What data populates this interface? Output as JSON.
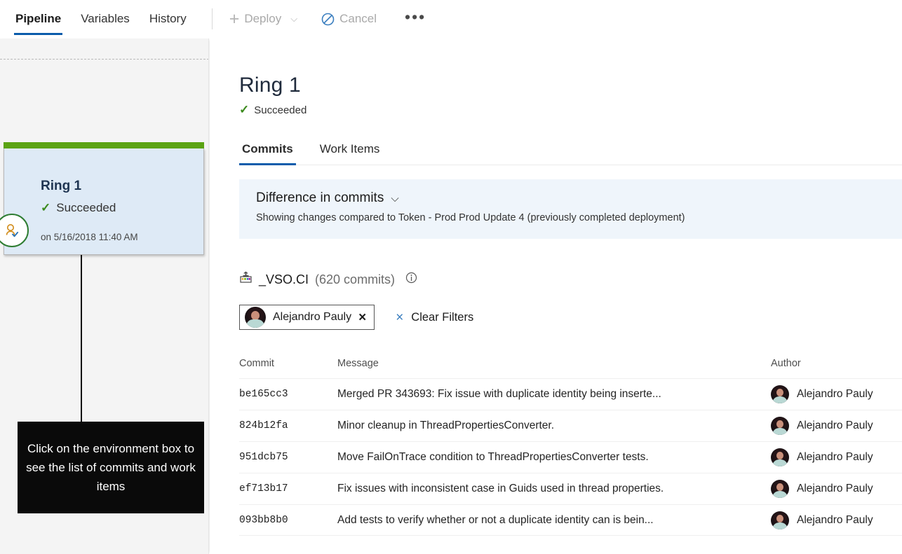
{
  "toolbar": {
    "tabs": [
      {
        "label": "Pipeline",
        "active": true
      },
      {
        "label": "Variables",
        "active": false
      },
      {
        "label": "History",
        "active": false
      }
    ],
    "deploy_label": "Deploy",
    "cancel_label": "Cancel",
    "more_label": "•••"
  },
  "pipeline_panel": {
    "environment": {
      "name": "Ring 1",
      "status": "Succeeded",
      "timestamp": "on 5/16/2018 11:40 AM",
      "status_color": "#5ba313",
      "card_color": "#deeaf6"
    },
    "callout": "Click on the environment box to see the list of commits and work items"
  },
  "details": {
    "title": "Ring 1",
    "status": "Succeeded",
    "tabs": [
      {
        "label": "Commits",
        "active": true
      },
      {
        "label": "Work Items",
        "active": false
      }
    ],
    "difference_banner": {
      "title": "Difference in commits",
      "subtitle": "Showing changes compared to Token - Prod Prod Update 4 (previously completed deployment)"
    },
    "repository": {
      "name": "_VSO.CI",
      "commit_count": "(620 commits)"
    },
    "filters": {
      "chip_label": "Alejandro Pauly",
      "chip_remove": "×",
      "clear_label": "Clear Filters",
      "clear_icon": "×"
    },
    "table": {
      "columns": [
        "Commit",
        "Message",
        "Author"
      ],
      "rows": [
        {
          "commit": "be165cc3",
          "message": "Merged PR 343693: Fix issue with duplicate identity being inserte...",
          "author": "Alejandro Pauly"
        },
        {
          "commit": "824b12fa",
          "message": "Minor cleanup in ThreadPropertiesConverter.",
          "author": "Alejandro Pauly"
        },
        {
          "commit": "951dcb75",
          "message": "Move FailOnTrace condition to ThreadPropertiesConverter tests.",
          "author": "Alejandro Pauly"
        },
        {
          "commit": "ef713b17",
          "message": "Fix issues with inconsistent case in Guids used in thread properties.",
          "author": "Alejandro Pauly"
        },
        {
          "commit": "093bb8b0",
          "message": "Add tests to verify whether or not a duplicate identity can is bein...",
          "author": "Alejandro Pauly"
        }
      ]
    }
  },
  "theme": {
    "accent_blue": "#0b5cab",
    "success_green": "#3b8a1d",
    "banner_blue": "#eff5fb"
  }
}
